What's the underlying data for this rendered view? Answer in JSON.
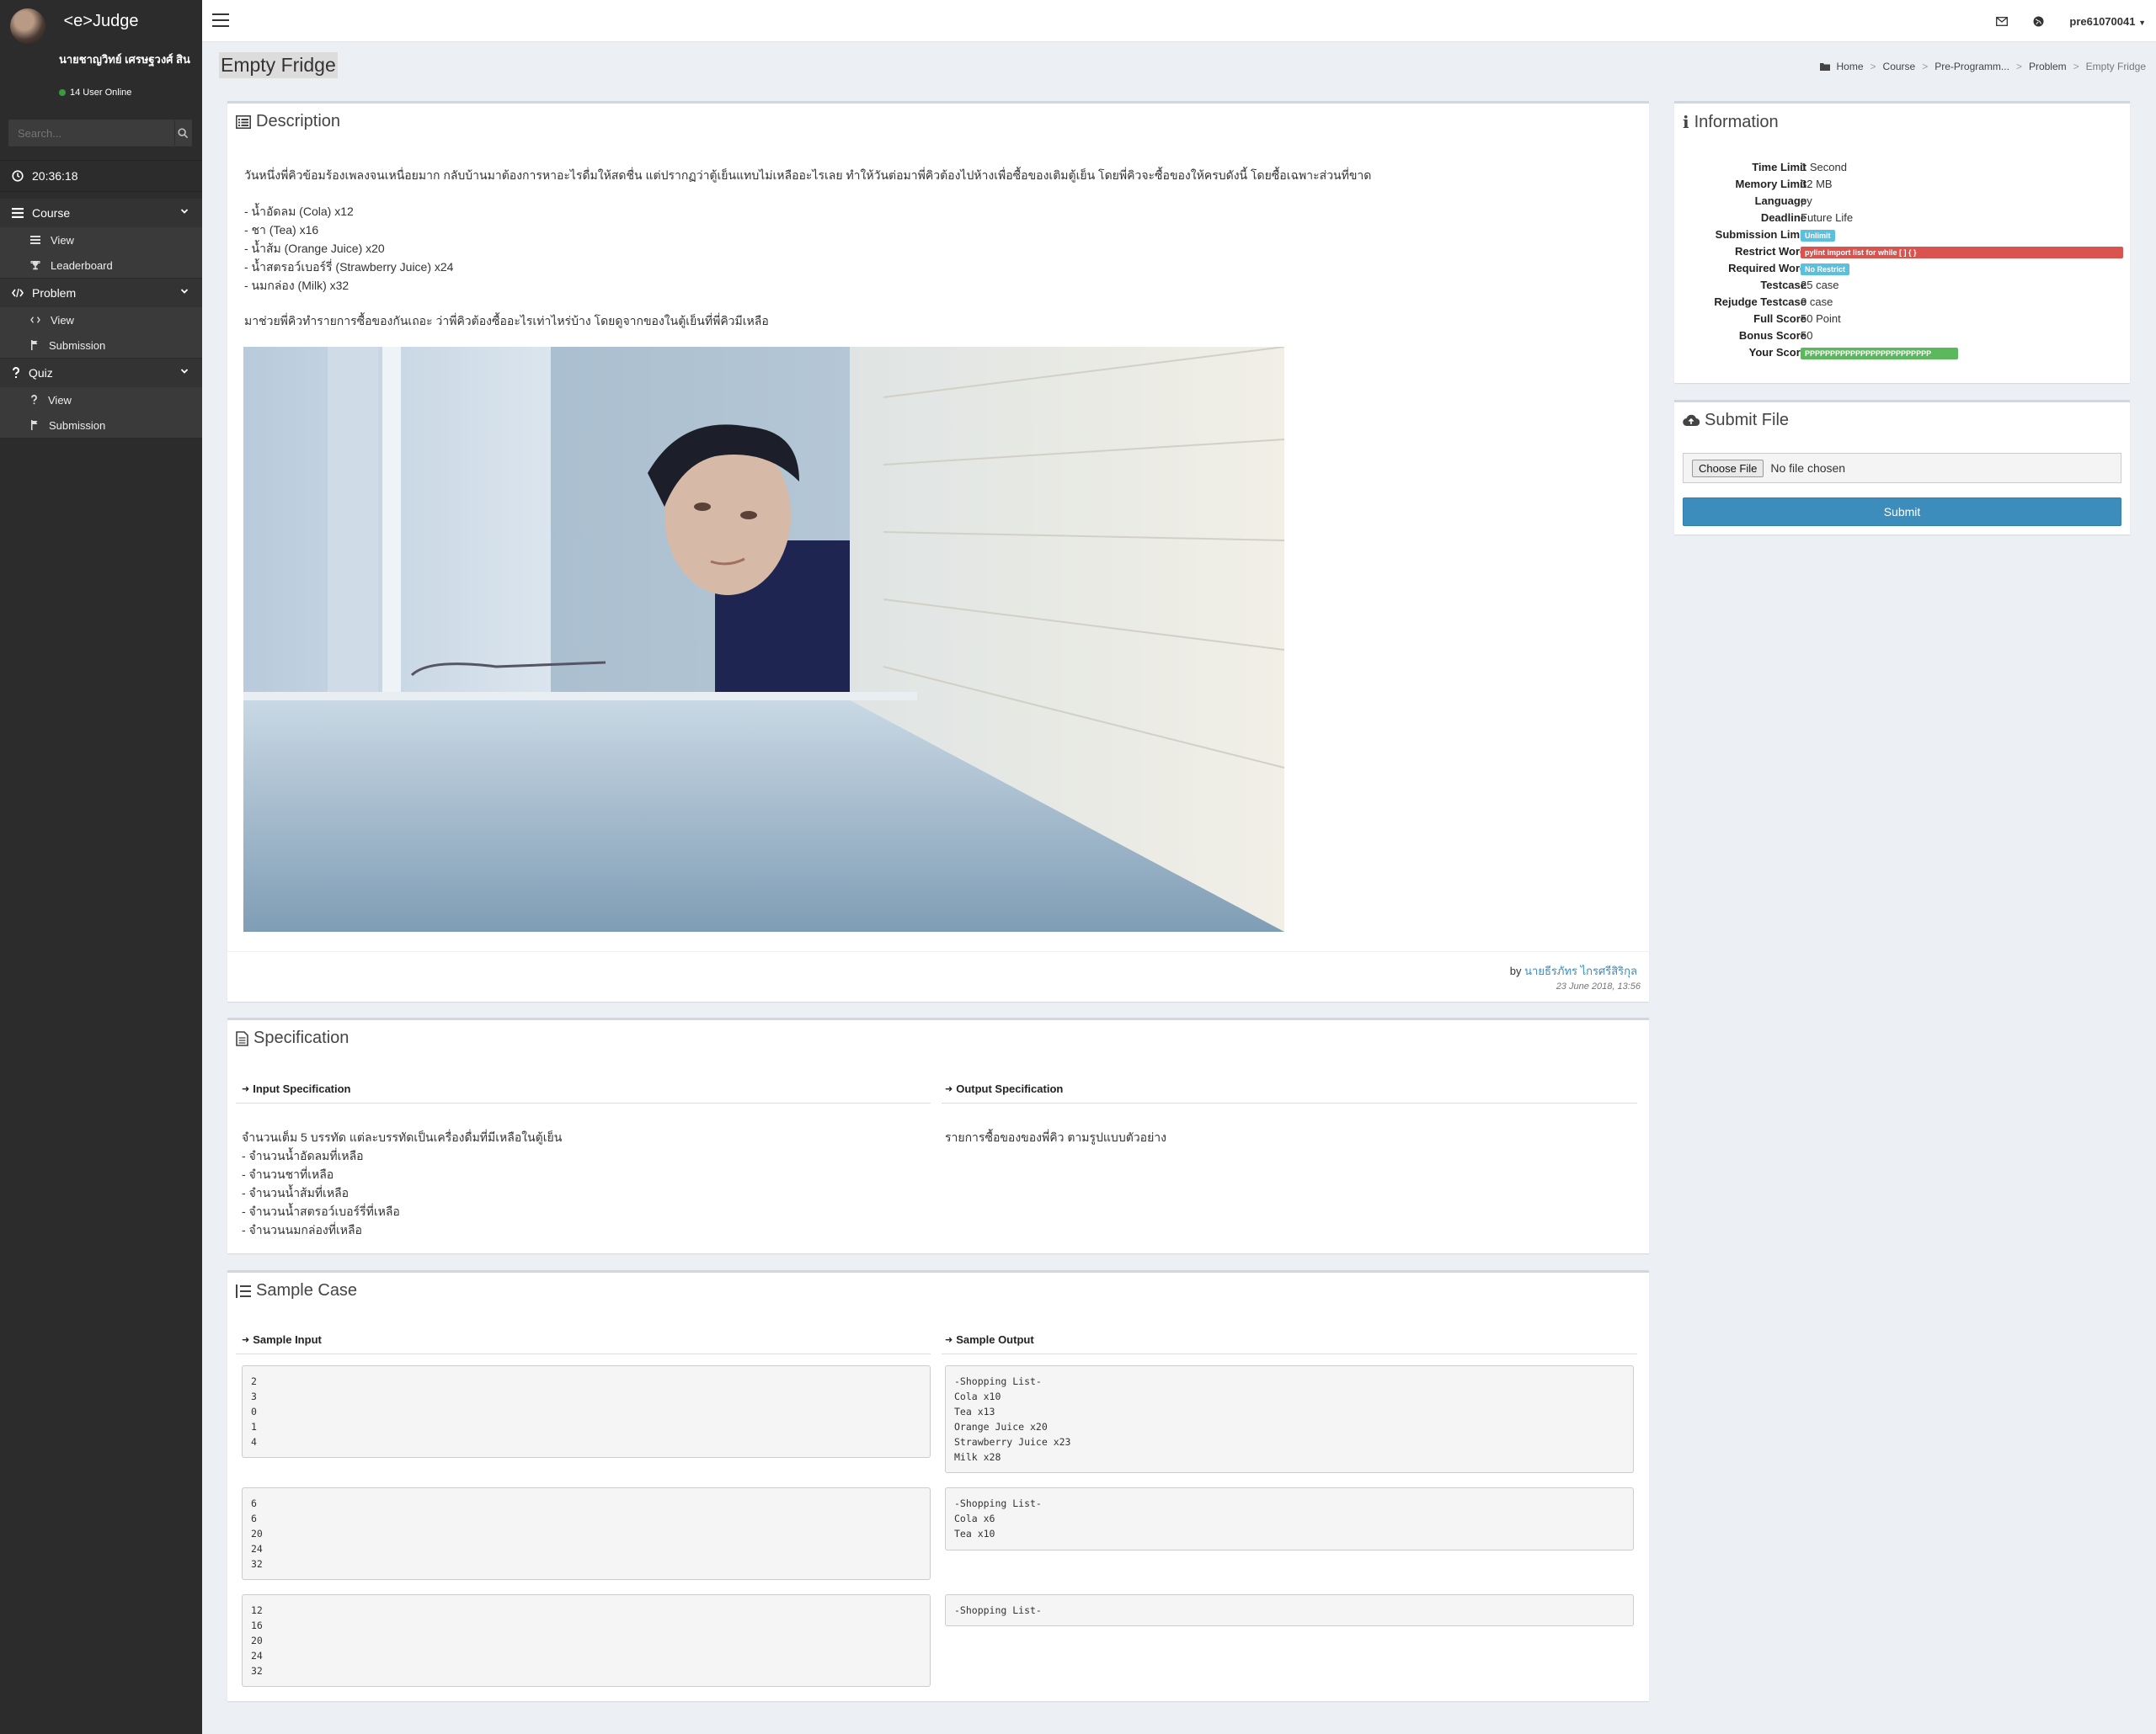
{
  "app": {
    "logo": "<e>Judge"
  },
  "sidebar": {
    "user_name": "นายชาญวิทย์ เศรษฐวงศ์ สิน",
    "online": "14 User Online",
    "search_placeholder": "Search...",
    "clock": "20:36:18",
    "groups": [
      {
        "label": "Course",
        "items": [
          {
            "label": "View"
          },
          {
            "label": "Leaderboard"
          }
        ]
      },
      {
        "label": "Problem",
        "items": [
          {
            "label": "View"
          },
          {
            "label": "Submission"
          }
        ]
      },
      {
        "label": "Quiz",
        "items": [
          {
            "label": "View"
          },
          {
            "label": "Submission"
          }
        ]
      }
    ]
  },
  "topbar": {
    "username": "pre61070041"
  },
  "page": {
    "title": "Empty Fridge",
    "breadcrumb": [
      "Home",
      "Course",
      "Pre-Programm...",
      "Problem",
      "Empty Fridge"
    ]
  },
  "description": {
    "title": "Description",
    "intro": "วันหนึ่งพี่คิวข้อมร้องเพลงจนเหนื่อยมาก กลับบ้านมาต้องการหาอะไรดื่มให้สดชื่น แต่ปรากฏว่าตู้เย็นแทบไม่เหลืออะไรเลย ทำให้วันต่อมาพี่คิวต้องไปห้างเพื่อซื้อของเติมตู้เย็น โดยพี่คิวจะซื้อของให้ครบดังนี้ โดยซื้อเฉพาะส่วนที่ขาด",
    "items": [
      "- น้ำอัดลม (Cola) x12",
      "- ชา (Tea) x16",
      "- น้ำส้ม (Orange Juice) x20",
      "- น้ำสตรอว์เบอร์รี่ (Strawberry Juice) x24",
      "- นมกล่อง (Milk) x32"
    ],
    "outro": "มาช่วยพี่คิวทำรายการซื้อของกันเถอะ ว่าพี่คิวต้องซื้ออะไรเท่าไหร่บ้าง โดยดูจากของในตู้เย็นที่พี่คิวมีเหลือ",
    "by_prefix": "by",
    "author": "นายธีรภัทร ไกรศรีสิริกุล",
    "date": "23 June 2018, 13:56"
  },
  "information": {
    "title": "Information",
    "rows": [
      {
        "label": "Time Limit",
        "value": "1 Second"
      },
      {
        "label": "Memory Limit",
        "value": "32 MB"
      },
      {
        "label": "Language",
        "value": "py"
      },
      {
        "label": "Deadline",
        "value": "Future Life"
      },
      {
        "label": "Submission Limit",
        "value": "Unlimit"
      },
      {
        "label": "Restrict Word",
        "value": "pylint import list for while [ ] { }"
      },
      {
        "label": "Required Word",
        "value": "No Restrict"
      },
      {
        "label": "Testcase",
        "value": "25 case"
      },
      {
        "label": "Rejudge Testcase",
        "value": "0 case"
      },
      {
        "label": "Full Score",
        "value": "50 Point"
      },
      {
        "label": "Bonus Score",
        "value": "50"
      },
      {
        "label": "Your Score",
        "value": "PPPPPPPPPPPPPPPPPPPPPPPPP"
      }
    ]
  },
  "submit": {
    "title": "Submit File",
    "choose_label": "Choose File",
    "no_file": "No file chosen",
    "button": "Submit"
  },
  "specification": {
    "title": "Specification",
    "input_title": "Input Specification",
    "output_title": "Output Specification",
    "input_lines": [
      "จำนวนเต็ม 5 บรรทัด แต่ละบรรทัดเป็นเครื่องดื่มที่มีเหลือในตู้เย็น",
      "- จำนวนน้ำอัดลมที่เหลือ",
      "- จำนวนชาที่เหลือ",
      "- จำนวนน้ำส้มที่เหลือ",
      "- จำนวนน้ำสตรอว์เบอร์รี่ที่เหลือ",
      "- จำนวนนมกล่องที่เหลือ"
    ],
    "output_text": "รายการซื้อของของพี่คิว ตามรูปแบบตัวอย่าง"
  },
  "samples": {
    "title": "Sample Case",
    "input_title": "Sample Input",
    "output_title": "Sample Output",
    "cases": [
      {
        "input": "2\n3\n0\n1\n4",
        "output": "-Shopping List-\nCola x10\nTea x13\nOrange Juice x20\nStrawberry Juice x23\nMilk x28"
      },
      {
        "input": "6\n6\n20\n24\n32",
        "output": "-Shopping List-\nCola x6\nTea x10"
      },
      {
        "input": "12\n16\n20\n24\n32",
        "output": "-Shopping List-"
      }
    ]
  }
}
